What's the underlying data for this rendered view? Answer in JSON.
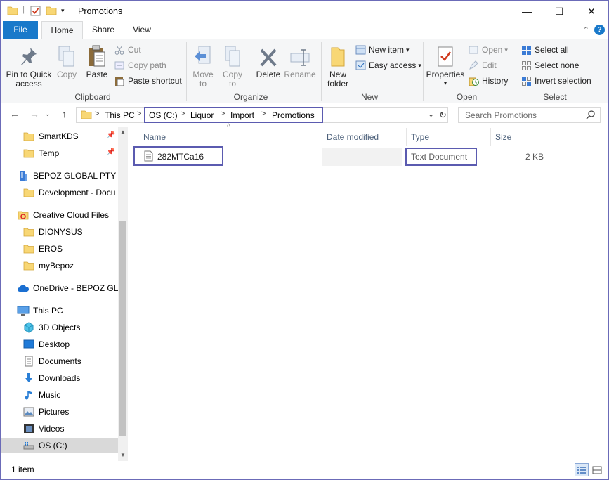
{
  "window": {
    "title": "Promotions",
    "controls": {
      "minimize": "—",
      "maximize": "☐",
      "close": "✕"
    }
  },
  "ribbon_tabs": [
    {
      "label": "File",
      "active": false
    },
    {
      "label": "Home",
      "active": true
    },
    {
      "label": "Share",
      "active": false
    },
    {
      "label": "View",
      "active": false
    }
  ],
  "ribbon": {
    "clipboard": {
      "group_label": "Clipboard",
      "pin_quick_access": "Pin to Quick\naccess",
      "copy": "Copy",
      "paste": "Paste",
      "cut": "Cut",
      "copy_path": "Copy path",
      "paste_shortcut": "Paste shortcut"
    },
    "organize": {
      "group_label": "Organize",
      "move_to": "Move\nto",
      "copy_to": "Copy\nto",
      "delete": "Delete",
      "rename": "Rename"
    },
    "new": {
      "group_label": "New",
      "new_folder": "New\nfolder",
      "new_item": "New item",
      "easy_access": "Easy access"
    },
    "open": {
      "group_label": "Open",
      "properties": "Properties",
      "open": "Open",
      "edit": "Edit",
      "history": "History"
    },
    "select": {
      "group_label": "Select",
      "select_all": "Select all",
      "select_none": "Select none",
      "invert_selection": "Invert selection"
    }
  },
  "address_bar": {
    "breadcrumbs": [
      "This PC",
      "OS (C:)",
      "Liquor",
      "Import",
      "Promotions"
    ],
    "separator": ">"
  },
  "search": {
    "placeholder": "Search Promotions"
  },
  "nav_pane": {
    "items": [
      {
        "label": "SmartKDS",
        "icon": "folder-icon",
        "pinned": true
      },
      {
        "label": "Temp",
        "icon": "folder-icon",
        "pinned": true
      },
      {
        "label": "BEPOZ GLOBAL PTY LI",
        "icon": "building-icon"
      },
      {
        "label": "Development - Docu",
        "icon": "folder-icon"
      },
      {
        "label": "Creative Cloud Files",
        "icon": "creative-cloud-icon"
      },
      {
        "label": "DIONYSUS",
        "icon": "folder-icon"
      },
      {
        "label": "EROS",
        "icon": "folder-icon"
      },
      {
        "label": "myBepoz",
        "icon": "folder-icon"
      },
      {
        "label": "OneDrive - BEPOZ GLC",
        "icon": "onedrive-icon"
      },
      {
        "label": "This PC",
        "icon": "pc-icon"
      },
      {
        "label": "3D Objects",
        "icon": "cube-icon"
      },
      {
        "label": "Desktop",
        "icon": "desktop-icon"
      },
      {
        "label": "Documents",
        "icon": "documents-icon"
      },
      {
        "label": "Downloads",
        "icon": "download-icon"
      },
      {
        "label": "Music",
        "icon": "music-icon"
      },
      {
        "label": "Pictures",
        "icon": "pictures-icon"
      },
      {
        "label": "Videos",
        "icon": "videos-icon"
      },
      {
        "label": "OS (C:)",
        "icon": "drive-icon",
        "selected": true
      }
    ]
  },
  "columns": {
    "name": "Name",
    "date_modified": "Date modified",
    "type": "Type",
    "size": "Size"
  },
  "files": [
    {
      "name": "282MTCa16",
      "date_modified": "",
      "type": "Text Document",
      "size": "2 KB"
    }
  ],
  "status": {
    "item_count": "1 item"
  },
  "colors": {
    "accent": "#1979ca",
    "highlight_box": "#5b5bb0",
    "folder": "#f8d775",
    "selection": "#d9d9d9"
  }
}
